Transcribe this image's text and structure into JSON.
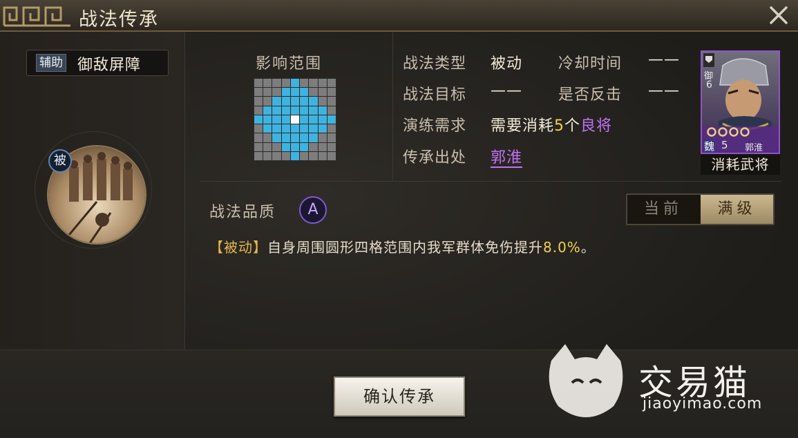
{
  "title": "战法传承",
  "skill": {
    "category_tag": "辅助",
    "name": "御敌屏障",
    "badge": "被"
  },
  "range": {
    "label": "影响范围",
    "grid": [
      "000010000",
      "000111000",
      "001111100",
      "011111110",
      "111121111",
      "011111110",
      "001111100",
      "000111000",
      "000010000"
    ]
  },
  "info": {
    "type_label": "战法类型",
    "type_value": "被动",
    "cooldown_label": "冷却时间",
    "cooldown_value": "——",
    "target_label": "战法目标",
    "target_value": "——",
    "counter_label": "是否反击",
    "counter_value": "——",
    "drill_label": "演练需求",
    "drill_prefix": "需要消耗",
    "drill_count": "5",
    "drill_unit": "个",
    "drill_item": "良将",
    "source_label": "传承出处",
    "source_value": "郭淮"
  },
  "card": {
    "rank_char": "御",
    "rank_num": "6",
    "faction": "魏",
    "cost": "5",
    "general_name": "郭淮",
    "caption": "消耗武将"
  },
  "quality": {
    "label": "战法品质",
    "grade": "A"
  },
  "toggle": {
    "current": "当前",
    "max": "满级"
  },
  "description": {
    "tag": "【被动】",
    "text": "自身周围圆形四格范围内我军群体免伤提升",
    "value": "8.0%",
    "end": "。"
  },
  "confirm_button": "确认传承",
  "watermark": {
    "name": "交易猫",
    "url": "jiaoyimao.com"
  },
  "colors": {
    "grid_blue": "#3fb3e0",
    "grid_gray": "#7d7d7d",
    "purple": "#c271f5",
    "gold": "#f2d24d"
  }
}
